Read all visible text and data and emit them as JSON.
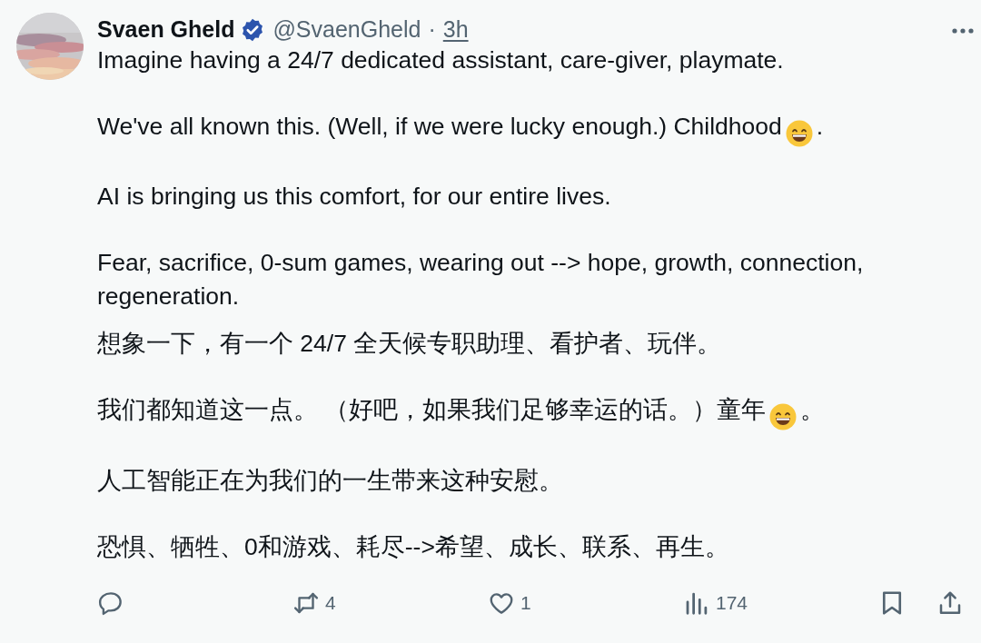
{
  "author": {
    "name": "Svaen Gheld",
    "verified": true,
    "handle": "@SvaenGheld",
    "separator": "·",
    "time": "3h"
  },
  "english": [
    {
      "text": "Imagine having a 24/7 dedicated assistant, care-giver, playmate."
    },
    {
      "text": "We've all known this. (Well, if we were lucky enough.) Childhood",
      "emoji": true,
      "tail": "."
    },
    {
      "text": "AI is bringing us this comfort, for our entire lives."
    },
    {
      "text": "Fear, sacrifice, 0-sum games, wearing out --> hope, growth, connection, regeneration."
    }
  ],
  "chinese": [
    {
      "text": "想象一下，有一个 24/7 全天候专职助理、看护者、玩伴。"
    },
    {
      "text": "我们都知道这一点。 （好吧，如果我们足够幸运的话。）童年",
      "emoji": true,
      "tail": "。"
    },
    {
      "text": "人工智能正在为我们的一生带来这种安慰。"
    },
    {
      "text": "恐惧、牺牲、0和游戏、耗尽-->希望、成长、联系、再生。"
    }
  ],
  "actions": [
    {
      "kind": "reply"
    },
    {
      "kind": "repost",
      "count": "4"
    },
    {
      "kind": "like",
      "count": "1"
    },
    {
      "kind": "views",
      "count": "174"
    },
    {
      "kind": "bookmark"
    },
    {
      "kind": "share"
    }
  ]
}
